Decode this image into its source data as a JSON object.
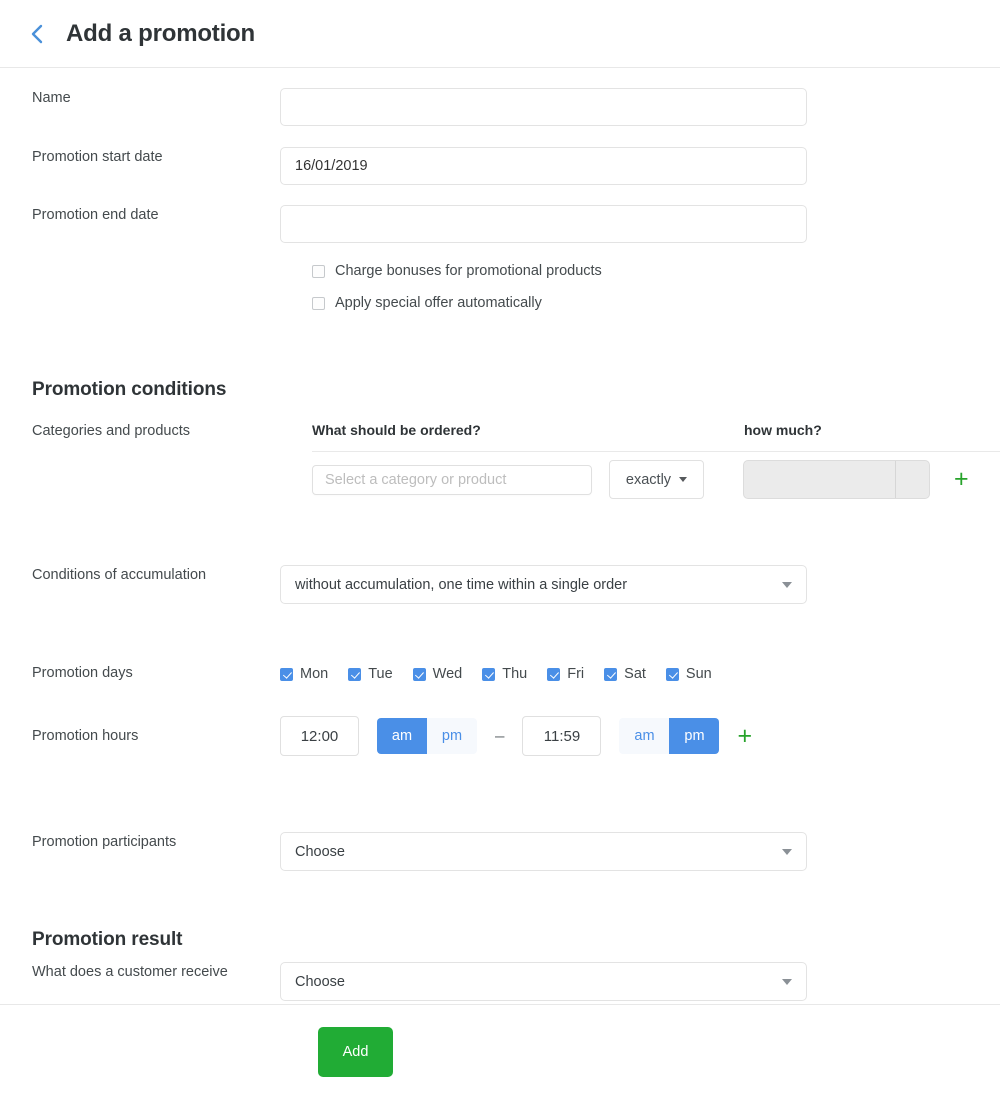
{
  "header": {
    "back_icon": "chevron-left-icon",
    "title": "Add a promotion"
  },
  "form": {
    "name": {
      "label": "Name",
      "value": "",
      "placeholder": ""
    },
    "start_date": {
      "label": "Promotion start date",
      "value": "16/01/2019",
      "placeholder": ""
    },
    "end_date": {
      "label": "Promotion end date",
      "value": "",
      "placeholder": ""
    },
    "checkboxes": [
      {
        "label": "Charge bonuses for promotional products",
        "checked": false
      },
      {
        "label": "Apply special offer automatically",
        "checked": false
      }
    ]
  },
  "conditions": {
    "heading": "Promotion conditions",
    "categories_label": "Categories and products",
    "columns": {
      "what": "What should be ordered?",
      "how_much": "how much?"
    },
    "category_input": {
      "value": "",
      "placeholder": "Select a category or product"
    },
    "operator_select": {
      "value": "exactly"
    },
    "quantity_input": {
      "value": "",
      "placeholder": ""
    },
    "add_row_icon": "plus-icon",
    "accumulation": {
      "label": "Conditions of accumulation",
      "value": "without accumulation, one time within a single order"
    },
    "days": {
      "label": "Promotion days",
      "items": [
        {
          "label": "Mon",
          "checked": true
        },
        {
          "label": "Tue",
          "checked": true
        },
        {
          "label": "Wed",
          "checked": true
        },
        {
          "label": "Thu",
          "checked": true
        },
        {
          "label": "Fri",
          "checked": true
        },
        {
          "label": "Sat",
          "checked": true
        },
        {
          "label": "Sun",
          "checked": true
        }
      ]
    },
    "hours": {
      "label": "Promotion hours",
      "from_time": "12:00",
      "from_am": "am",
      "from_pm": "pm",
      "from_active": "am",
      "separator": "–",
      "to_time": "11:59",
      "to_am": "am",
      "to_pm": "pm",
      "to_active": "pm",
      "add_icon": "plus-icon"
    },
    "participants": {
      "label": "Promotion participants",
      "value": "Choose"
    }
  },
  "result": {
    "heading": "Promotion result",
    "customer_receive": {
      "label": "What does a customer receive",
      "value": "Choose"
    }
  },
  "footer": {
    "add_label": "Add"
  },
  "colors": {
    "accent_blue": "#4a8fe7",
    "green": "#21ac35",
    "text": "#2f3437"
  }
}
